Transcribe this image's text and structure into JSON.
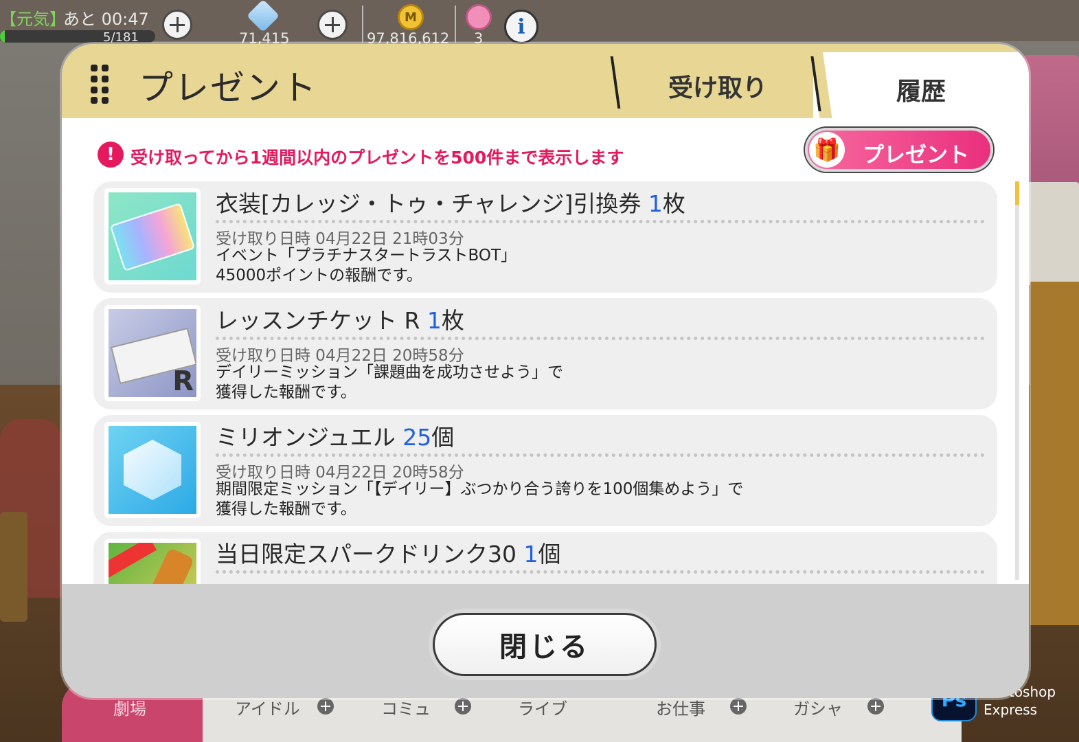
{
  "status_bar": {
    "stamina_label": "【元気】",
    "stamina_time": "あと 00:47",
    "stamina_count": "5/181",
    "stamina_fill": 0.03,
    "jewels": "71,415",
    "money": "97,816,612",
    "money_icon_text": "M",
    "tickets": "3",
    "info_label": "i"
  },
  "dialog": {
    "title": "プレゼント",
    "tabs": [
      {
        "label": "受け取り",
        "active": false
      },
      {
        "label": "履歴",
        "active": true
      }
    ],
    "notice_icon": "!",
    "notice": "受け取ってから1週間以内のプレゼントを500件まで表示します",
    "present_button_label": "プレゼント",
    "present_button_icon": "gift-icon",
    "close_label": "閉じる",
    "items": [
      {
        "name": "衣装[カレッジ・トゥ・チャレンジ]引換券",
        "qty": "1",
        "unit": "枚",
        "date": "受け取り日時 04月22日 21時03分",
        "desc": "イベント「プラチナスタートラストBOT」\n45000ポイントの報酬です。",
        "icon": "costume-voucher-icon"
      },
      {
        "name": "レッスンチケット R",
        "qty": "1",
        "unit": "枚",
        "date": "受け取り日時 04月22日 20時58分",
        "desc": "デイリーミッション「課題曲を成功させよう」で\n獲得した報酬です。",
        "icon": "lesson-ticket-icon"
      },
      {
        "name": "ミリオンジュエル",
        "qty": "25",
        "unit": "個",
        "date": "受け取り日時 04月22日 20時58分",
        "desc": "期間限定ミッション「【デイリー】ぶつかり合う誇りを100個集めよう」で\n獲得した報酬です。",
        "icon": "million-jewel-icon"
      },
      {
        "name": "当日限定スパークドリンク30",
        "qty": "1",
        "unit": "個",
        "date": "",
        "desc": "",
        "icon": "spark-drink-icon"
      }
    ]
  },
  "bottom_nav": {
    "items": [
      "劇場",
      "アイドル",
      "コミュ",
      "ライブ",
      "お仕事",
      "ガシャ"
    ]
  },
  "watermark": {
    "badge": "Ps",
    "line1": "Photoshop",
    "line2": "Express"
  },
  "colors": {
    "header": "#e8d794",
    "accent_pink": "#e5195e",
    "qty_blue": "#1f5fe0"
  }
}
